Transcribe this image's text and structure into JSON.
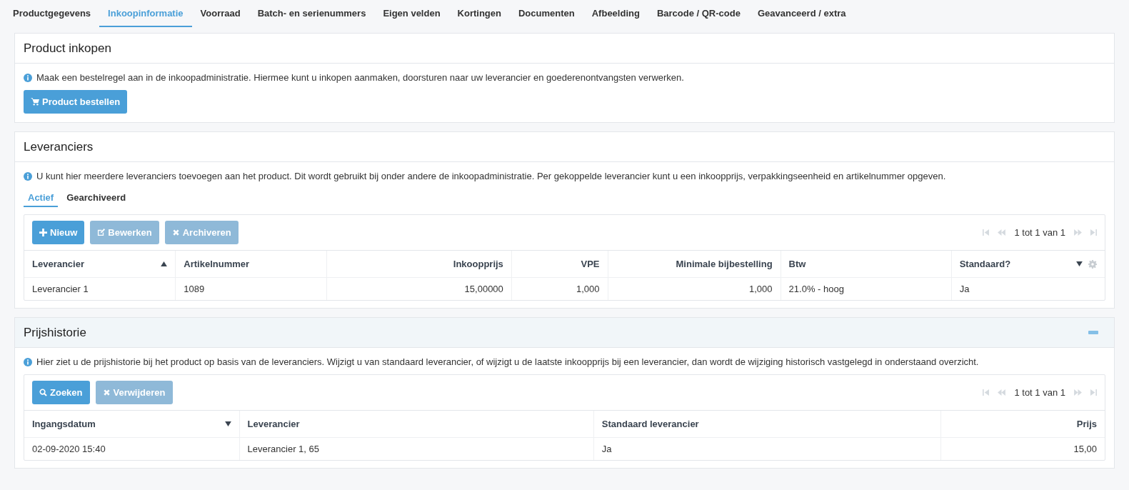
{
  "tabs": [
    {
      "label": "Productgegevens",
      "selected": false
    },
    {
      "label": "Inkoopinformatie",
      "selected": true
    },
    {
      "label": "Voorraad",
      "selected": false
    },
    {
      "label": "Batch- en serienummers",
      "selected": false
    },
    {
      "label": "Eigen velden",
      "selected": false
    },
    {
      "label": "Kortingen",
      "selected": false
    },
    {
      "label": "Documenten",
      "selected": false
    },
    {
      "label": "Afbeelding",
      "selected": false
    },
    {
      "label": "Barcode / QR-code",
      "selected": false
    },
    {
      "label": "Geavanceerd / extra",
      "selected": false
    }
  ],
  "product_inkopen": {
    "title": "Product inkopen",
    "info": "Maak een bestelregel aan in de inkoopadministratie. Hiermee kunt u inkopen aanmaken, doorsturen naar uw leverancier en goederenontvangsten verwerken.",
    "button": "Product bestellen"
  },
  "leveranciers": {
    "title": "Leveranciers",
    "info": "U kunt hier meerdere leveranciers toevoegen aan het product. Dit wordt gebruikt bij onder andere de inkoopadministratie. Per gekoppelde leverancier kunt u een inkoopprijs, verpakkingseenheid en artikelnummer opgeven.",
    "tabs": [
      {
        "label": "Actief",
        "selected": true
      },
      {
        "label": "Gearchiveerd",
        "selected": false
      }
    ],
    "buttons": [
      {
        "label": "Nieuw",
        "disabled": false
      },
      {
        "label": "Bewerken",
        "disabled": true
      },
      {
        "label": "Archiveren",
        "disabled": true
      }
    ],
    "pager": "1 tot 1 van 1",
    "columns": [
      {
        "label": "Leverancier",
        "kind": "text",
        "sort_descending": false
      },
      {
        "label": "Artikelnummer",
        "kind": "text"
      },
      {
        "label": "Inkoopprijs",
        "kind": "number"
      },
      {
        "label": "VPE",
        "kind": "number"
      },
      {
        "label": "Minimale bijbestelling",
        "kind": "number"
      },
      {
        "label": "Btw",
        "kind": "text"
      },
      {
        "label": "Standaard?",
        "kind": "text",
        "sort_descending": true,
        "settings": true
      }
    ],
    "rows": [
      [
        "Leverancier 1",
        "1089",
        "15,00000",
        "1,000",
        "1,000",
        "21.0% - hoog",
        "Ja"
      ]
    ]
  },
  "prijshistorie": {
    "title": "Prijshistorie",
    "collapsible": true,
    "info": "Hier ziet u de prijshistorie bij het product op basis van de leveranciers. Wijzigt u van standaard leverancier, of wijzigt u de laatste inkoopprijs bij een leverancier, dan wordt de wijziging historisch vastgelegd in onderstaand overzicht.",
    "buttons": [
      {
        "label": "Zoeken",
        "disabled": false
      },
      {
        "label": "Verwijderen",
        "disabled": true
      }
    ],
    "pager": "1 tot 1 van 1",
    "columns": [
      {
        "label": "Ingangsdatum",
        "kind": "text",
        "sort_descending": true
      },
      {
        "label": "Leverancier",
        "kind": "text"
      },
      {
        "label": "Standaard leverancier",
        "kind": "text"
      },
      {
        "label": "Prijs",
        "kind": "number"
      }
    ],
    "rows": [
      [
        "02-09-2020 15:40",
        "Leverancier 1, 65",
        "Ja",
        "15,00"
      ]
    ]
  }
}
